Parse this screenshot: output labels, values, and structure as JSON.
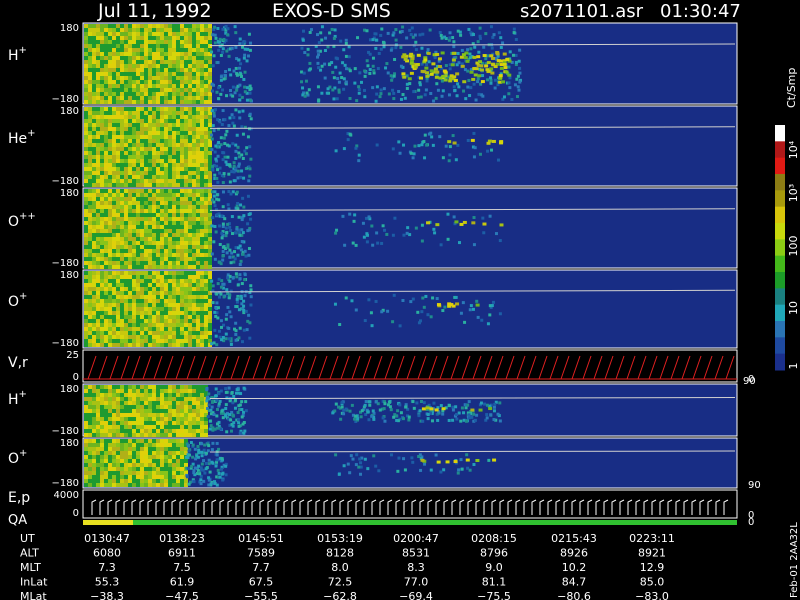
{
  "header": {
    "date": "Jul 11, 1992",
    "instrument": "EXOS-D SMS",
    "filename": "s2071101.asr",
    "time": "01:30:47"
  },
  "colorbar": {
    "label": "Ct/Smp",
    "tick_labels": [
      "10⁴",
      "10³",
      "100",
      "10",
      "1"
    ],
    "tick_values": [
      10000,
      1000,
      100,
      10,
      1
    ],
    "colors": [
      "#ffffff",
      "#b01818",
      "#e01a14",
      "#8c7c14",
      "#a89a0c",
      "#d8c40a",
      "#c8d80c",
      "#8ccc14",
      "#44b81a",
      "#1c9c28",
      "#1a8080",
      "#20a8b8",
      "#2a74b4",
      "#1e4aa0",
      "#1a2f8c"
    ]
  },
  "panels": [
    {
      "id": "h-plus",
      "label": "H",
      "sup": "+",
      "y_max_label": "180",
      "y_min_label": "−180"
    },
    {
      "id": "he-plus",
      "label": "He",
      "sup": "+",
      "y_max_label": "180",
      "y_min_label": "−180"
    },
    {
      "id": "o-plus-plus",
      "label": "O",
      "sup": "++",
      "y_max_label": "180",
      "y_min_label": "−180"
    },
    {
      "id": "o-plus",
      "label": "O",
      "sup": "+",
      "y_max_label": "180",
      "y_min_label": "−180"
    },
    {
      "id": "vr",
      "label": "V,r",
      "y_max_label": "25",
      "y_min_label": "0",
      "right_top_label": "90",
      "right_bottom_label": "0"
    },
    {
      "id": "h-plus-2",
      "label": "H",
      "sup": "+",
      "y_max_label": "180",
      "y_min_label": "−180"
    },
    {
      "id": "o-plus-2",
      "label": "O",
      "sup": "+",
      "y_max_label": "180",
      "y_min_label": "−180",
      "right_bottom_label": "90"
    },
    {
      "id": "ep",
      "label": "E,p",
      "y_max_label": "4000",
      "y_min_label": "0",
      "right_bottom_label": "0"
    }
  ],
  "qa_label": "QA",
  "footer_code": "Feb-01 2AA32L",
  "chart_data": {
    "type": "heatmap",
    "title": "Jul 11, 1992   EXOS-D SMS",
    "x_axis_rows": [
      {
        "label": "UT",
        "values": [
          "0130:47",
          "0138:23",
          "0145:51",
          "0153:19",
          "0200:47",
          "0208:15",
          "0215:43",
          "0223:11"
        ]
      },
      {
        "label": "ALT",
        "values": [
          "6080",
          "6911",
          "7589",
          "8128",
          "8531",
          "8796",
          "8926",
          "8921"
        ]
      },
      {
        "label": "MLT",
        "values": [
          "7.3",
          "7.5",
          "7.7",
          "8.0",
          "8.3",
          "9.0",
          "10.2",
          "12.9"
        ]
      },
      {
        "label": "InLat",
        "values": [
          "55.3",
          "61.9",
          "67.5",
          "72.5",
          "77.0",
          "81.1",
          "84.7",
          "85.0"
        ]
      },
      {
        "label": "MLat",
        "values": [
          "−38.3",
          "−47.5",
          "−55.5",
          "−62.8",
          "−69.4",
          "−75.5",
          "−80.6",
          "−83.0"
        ]
      }
    ],
    "colorscale": "log",
    "colorbar_range": [
      1,
      10000
    ],
    "panels_y_range": [
      -180,
      180
    ]
  }
}
